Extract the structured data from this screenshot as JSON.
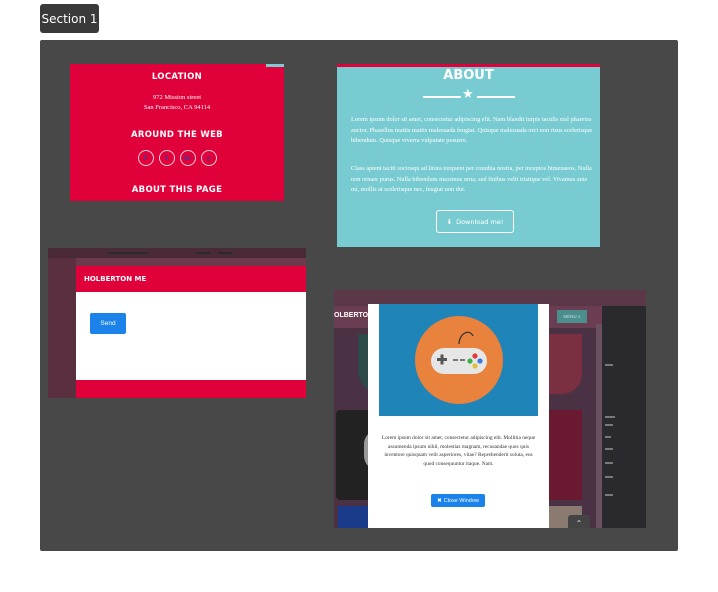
{
  "section_button": "Section 1",
  "tile_location": {
    "location_heading": "LOCATION",
    "address_line1": "972 Mission street",
    "address_line2": "San Francisco, CA 94114",
    "web_heading": "AROUND THE WEB",
    "socials": [
      "facebook-icon",
      "twitter-icon",
      "linkedin-icon",
      "dribbble-icon"
    ],
    "about_heading": "ABOUT THIS PAGE",
    "colors": {
      "background": "#e0003a",
      "accent": "#7ccbd2"
    }
  },
  "tile_about": {
    "title": "ABOUT",
    "paragraph1": "Lorem ipsum dolor sit amet, consectetur adipiscing elit. Nam blandit turpis iaculis nisl pharetra auctor. Phasellus mattis mattis malesuada feugiat. Quisque malesuada orci non risus scelerisque bibendum. Quisque viverra vulputate posuere.",
    "paragraph2": "Class aptent taciti sociosqu ad litora torquent per conubia nostra, per inceptos himenaeos. Nulla non ornare purus. Nulla bibendum maximus urna, sed finibus velit tristique vel. Vivamus ante mi, mollis at scelerisque nec, feugiat non dui.",
    "download_label": "Download me!",
    "colors": {
      "background": "#78cbd0"
    }
  },
  "tile_contact": {
    "header_title": "HOLBERTON ME",
    "send_label": "Send"
  },
  "tile_modal": {
    "brand": "OLBERTO",
    "menu_label": "MENU ≡",
    "body_text": "Lorem ipsum dolor sit amet, consectetur adipiscing elit. Mollitia neque assumenda ipsum nihil, molestias magnam, recusandae quos quis inventore quisquam velit asperiores, vitae? Reprehenderit soluta, eos quod consequuntur itaque. Nam.",
    "close_label": "Close Window",
    "back_to_top": "⌃"
  }
}
